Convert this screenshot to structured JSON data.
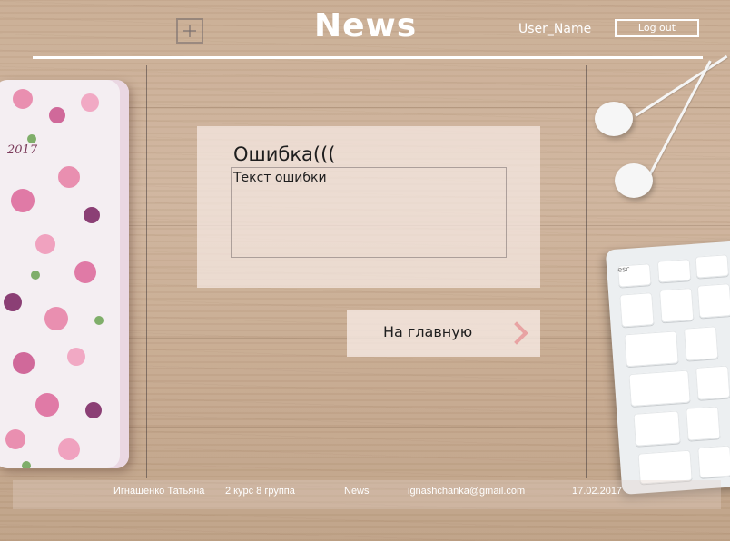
{
  "header": {
    "logo": "News",
    "user_name": "User_Name",
    "logout_label": "Log out"
  },
  "error": {
    "title": "Ошибка(((",
    "text": "Текст ошибки"
  },
  "home_button": {
    "label": "На главную"
  },
  "footer": {
    "author": "Игнащенко Татьяна",
    "group": "2 курс 8 группа",
    "site": "News",
    "email": "ignashchanka@gmail.com",
    "date": "17.02.2017"
  },
  "decor": {
    "notebook_year": "2017"
  },
  "icons": {
    "add": "plus-square-icon",
    "home_arrow": "chevron-right-icon"
  },
  "colors": {
    "accent_arrow": "#e8a3a3",
    "header_text": "#ffffff",
    "card_bg": "#f6eae4"
  }
}
